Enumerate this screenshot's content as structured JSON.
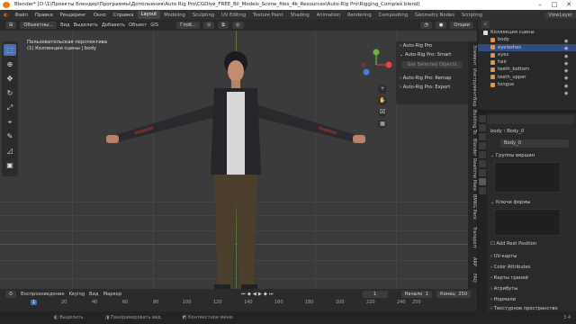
{
  "titlebar": {
    "text": "Blender* [D:\\1\\Проекты блендер\\Программы\\Дополнения\\Auto Rig Pro\\CGDive_FREE_Bil_Models_Scene_files_4k_Resources\\Auto-Rig Pro\\Rigging_Complex.blend]"
  },
  "menu": [
    "Файл",
    "Правка",
    "Рендеринг",
    "Окно",
    "Справка"
  ],
  "workspaces": [
    {
      "label": "Layout",
      "active": true
    },
    {
      "label": "Modeling"
    },
    {
      "label": "Sculpting"
    },
    {
      "label": "UV Editing"
    },
    {
      "label": "Texture Paint"
    },
    {
      "label": "Shading"
    },
    {
      "label": "Animation"
    },
    {
      "label": "Rendering"
    },
    {
      "label": "Compositing"
    },
    {
      "label": "Geometry Nodes"
    },
    {
      "label": "Scripting"
    }
  ],
  "view_layer": "ViewLayer",
  "header": {
    "mode": "Объектны...",
    "view": "Вид",
    "select": "Выделить",
    "add": "Добавить",
    "object": "Объект",
    "gis": "GIS",
    "transform": "Глоб...",
    "options": "Опции"
  },
  "viewport": {
    "line1": "Пользовательская перспектива",
    "line2": "(1) Коллекция сцены | body"
  },
  "npanel": {
    "arp": "Auto-Rig Pro",
    "smart": "Auto-Rig Pro: Smart",
    "get_selected": "Get Selected Objects",
    "remap": "Auto-Rig Pro: Remap",
    "export": "Auto-Rig Pro: Export"
  },
  "vertical_tabs": [
    "Элемент",
    "Инструмент",
    "Вид",
    "Building To",
    "Blender",
    "Realtime Mate",
    "BMKG Pack",
    "Transport",
    "ARP",
    "FAQ"
  ],
  "outliner": {
    "root": "Коллекция сцены",
    "items": [
      {
        "label": "body",
        "selected": false
      },
      {
        "label": "eyelashes",
        "selected": true
      },
      {
        "label": "eyes",
        "selected": false
      },
      {
        "label": "hair",
        "selected": false
      },
      {
        "label": "teeth_bottom",
        "selected": false
      },
      {
        "label": "teeth_upper",
        "selected": false
      },
      {
        "label": "tongue",
        "selected": false
      }
    ]
  },
  "properties": {
    "object": "body",
    "mesh": "Body_0",
    "data_name": "Body_0",
    "vertex_groups": "Группы вершин",
    "shape_keys": "Ключи формы",
    "add_rest": "Add Rest Position",
    "sections": [
      "UV-карты",
      "Color Attributes",
      "Карты граней",
      "Атрибуты",
      "Нормали",
      "Текстурное пространство"
    ]
  },
  "timeline": {
    "playback": "Воспроизведение",
    "keying": "Keying",
    "view": "Вид",
    "marker": "Маркер",
    "current_frame": "1",
    "start_label": "Начало",
    "start": "1",
    "end_label": "Конец",
    "end": "250",
    "ticks": [
      "1",
      "20",
      "40",
      "60",
      "80",
      "100",
      "120",
      "140",
      "160",
      "180",
      "200",
      "220",
      "240",
      "250"
    ]
  },
  "status": {
    "select": "Выделить",
    "pan": "Панорамировать вид",
    "context": "Контекстное меню",
    "version": "3.4"
  }
}
